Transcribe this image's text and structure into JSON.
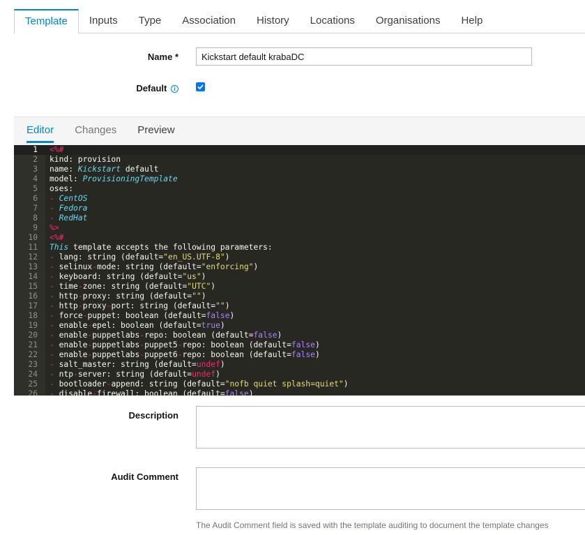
{
  "tabs": [
    "Template",
    "Inputs",
    "Type",
    "Association",
    "History",
    "Locations",
    "Organisations",
    "Help"
  ],
  "name_label": "Name *",
  "name_value": "Kickstart default krabaDC",
  "default_label": "Default",
  "default_checked": true,
  "editor_tabs": [
    "Editor",
    "Changes",
    "Preview"
  ],
  "code_lines": [
    [
      [
        "k",
        "<%#"
      ]
    ],
    [
      [
        "",
        "kind: provision"
      ]
    ],
    [
      [
        "",
        "name: "
      ],
      [
        "i",
        "Kickstart"
      ],
      [
        "",
        " default"
      ]
    ],
    [
      [
        "",
        "model: "
      ],
      [
        "i",
        "ProvisioningTemplate"
      ]
    ],
    [
      [
        "",
        "oses:"
      ]
    ],
    [
      [
        "k",
        "- "
      ],
      [
        "i",
        "CentOS"
      ]
    ],
    [
      [
        "k",
        "- "
      ],
      [
        "i",
        "Fedora"
      ]
    ],
    [
      [
        "k",
        "- "
      ],
      [
        "i",
        "RedHat"
      ]
    ],
    [
      [
        "k",
        "%>"
      ]
    ],
    [
      [
        "k",
        "<%#"
      ]
    ],
    [
      [
        "i",
        "This"
      ],
      [
        "",
        " template accepts the following parameters:"
      ]
    ],
    [
      [
        "k",
        "- "
      ],
      [
        "",
        "lang: string (default="
      ],
      [
        "s",
        "\"en_US.UTF-8\""
      ],
      [
        "",
        ")"
      ]
    ],
    [
      [
        "k",
        "- "
      ],
      [
        "",
        "selinux"
      ],
      [
        "k",
        "-"
      ],
      [
        "",
        "mode: string (default="
      ],
      [
        "s",
        "\"enforcing\""
      ],
      [
        "",
        ")"
      ]
    ],
    [
      [
        "k",
        "- "
      ],
      [
        "",
        "keyboard: string (default="
      ],
      [
        "s",
        "\"us\""
      ],
      [
        "",
        ")"
      ]
    ],
    [
      [
        "k",
        "- "
      ],
      [
        "",
        "time"
      ],
      [
        "k",
        "-"
      ],
      [
        "",
        "zone: string (default="
      ],
      [
        "s",
        "\"UTC\""
      ],
      [
        "",
        ")"
      ]
    ],
    [
      [
        "k",
        "- "
      ],
      [
        "",
        "http"
      ],
      [
        "k",
        "-"
      ],
      [
        "",
        "proxy: string (default="
      ],
      [
        "s",
        "\"\""
      ],
      [
        "",
        ")"
      ]
    ],
    [
      [
        "k",
        "- "
      ],
      [
        "",
        "http"
      ],
      [
        "k",
        "-"
      ],
      [
        "",
        "proxy"
      ],
      [
        "k",
        "-"
      ],
      [
        "",
        "port: string (default="
      ],
      [
        "s",
        "\"\""
      ],
      [
        "",
        ")"
      ]
    ],
    [
      [
        "k",
        "- "
      ],
      [
        "",
        "force"
      ],
      [
        "k",
        "-"
      ],
      [
        "",
        "puppet: boolean (default="
      ],
      [
        "c",
        "false"
      ],
      [
        "",
        ")"
      ]
    ],
    [
      [
        "k",
        "- "
      ],
      [
        "",
        "enable"
      ],
      [
        "k",
        "-"
      ],
      [
        "",
        "epel: boolean (default="
      ],
      [
        "c",
        "true"
      ],
      [
        "",
        ")"
      ]
    ],
    [
      [
        "k",
        "- "
      ],
      [
        "",
        "enable"
      ],
      [
        "k",
        "-"
      ],
      [
        "",
        "puppetlabs"
      ],
      [
        "k",
        "-"
      ],
      [
        "",
        "repo: boolean (default="
      ],
      [
        "c",
        "false"
      ],
      [
        "",
        ")"
      ]
    ],
    [
      [
        "k",
        "- "
      ],
      [
        "",
        "enable"
      ],
      [
        "k",
        "-"
      ],
      [
        "",
        "puppetlabs"
      ],
      [
        "k",
        "-"
      ],
      [
        "",
        "puppet5"
      ],
      [
        "k",
        "-"
      ],
      [
        "",
        "repo: boolean (default="
      ],
      [
        "c",
        "false"
      ],
      [
        "",
        ")"
      ]
    ],
    [
      [
        "k",
        "- "
      ],
      [
        "",
        "enable"
      ],
      [
        "k",
        "-"
      ],
      [
        "",
        "puppetlabs"
      ],
      [
        "k",
        "-"
      ],
      [
        "",
        "puppet6"
      ],
      [
        "k",
        "-"
      ],
      [
        "",
        "repo: boolean (default="
      ],
      [
        "c",
        "false"
      ],
      [
        "",
        ")"
      ]
    ],
    [
      [
        "k",
        "- "
      ],
      [
        "",
        "salt_master: string (default="
      ],
      [
        "k",
        "undef"
      ],
      [
        "",
        ")"
      ]
    ],
    [
      [
        "k",
        "- "
      ],
      [
        "",
        "ntp"
      ],
      [
        "k",
        "-"
      ],
      [
        "",
        "server: string (default="
      ],
      [
        "k",
        "undef"
      ],
      [
        "",
        ")"
      ]
    ],
    [
      [
        "k",
        "- "
      ],
      [
        "",
        "bootloader"
      ],
      [
        "k",
        "-"
      ],
      [
        "",
        "append: string (default="
      ],
      [
        "s",
        "\"nofb quiet splash=quiet\""
      ],
      [
        "",
        ")"
      ]
    ],
    [
      [
        "k",
        "- "
      ],
      [
        "",
        "disable"
      ],
      [
        "k",
        "-"
      ],
      [
        "",
        "firewall: boolean (default="
      ],
      [
        "c",
        "false"
      ],
      [
        "",
        ")"
      ]
    ]
  ],
  "description_label": "Description",
  "audit_label": "Audit Comment",
  "audit_help": "The Audit Comment field is saved with the template auditing to document the template changes",
  "colors": {
    "accent": "#0088ce",
    "editor_bg": "#272822",
    "keyword": "#f92672",
    "string": "#e6db74",
    "constant": "#ae81ff",
    "type": "#66d9ef"
  }
}
